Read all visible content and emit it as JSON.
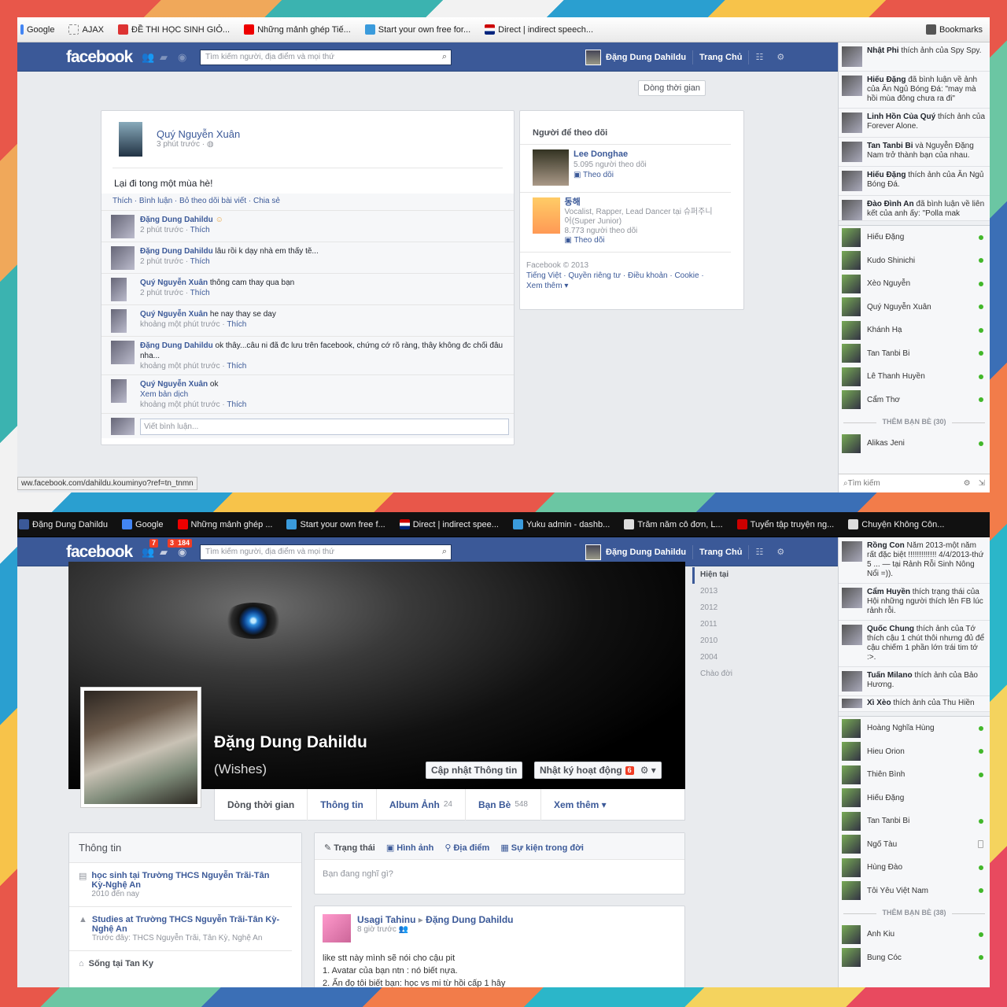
{
  "s1": {
    "bookmarks": [
      "Google",
      "AJAX",
      "ĐỀ THI HỌC SINH GIỎ...",
      "Những mảnh ghép Tiế...",
      "Start your own free for...",
      "Direct | indirect speech..."
    ],
    "bookmarks_right": "Bookmarks",
    "logo": "facebook",
    "search_placeholder": "Tìm kiếm người, địa điểm và mọi thứ",
    "user": "Đặng Dung Dahildu",
    "home": "Trang Chủ",
    "timeline_btn": "Dòng thời gian",
    "post": {
      "author": "Quý Nguyễn Xuân",
      "time": "3 phút trước · ",
      "text": "Lại đi tong một mùa hè!",
      "actions": "Thích · Bình luận · Bỏ theo dõi bài viết · Chia sẻ",
      "comments": [
        {
          "name": "Đặng Dung Dahildu",
          "text": " ",
          "meta": "2 phút trước · ",
          "like": "Thích"
        },
        {
          "name": "Đặng Dung Dahildu",
          "text": " lâu rồi k dạy nhà em thấy tẽ...",
          "meta": "2 phút trước · ",
          "like": "Thích"
        },
        {
          "name": "Quý Nguyễn Xuân",
          "text": " thông cam thay qua bạn",
          "meta": "2 phút trước · ",
          "like": "Thích"
        },
        {
          "name": "Quý Nguyễn Xuân",
          "text": " he nay thay se day",
          "meta": "khoảng một phút trước · ",
          "like": "Thích"
        },
        {
          "name": "Đặng Dung Dahildu",
          "text": " ok thây...câu ni đã đc lưu trên facebook, chứng cớ rõ ràng, thây không đc chối đâu nha...",
          "meta": "khoảng một phút trước · ",
          "like": "Thích"
        },
        {
          "name": "Quý Nguyễn Xuân",
          "text": " ok",
          "extra": "Xem bản dịch",
          "meta": "khoảng một phút trước · ",
          "like": "Thích"
        }
      ],
      "write": "Viết bình luận..."
    },
    "follow": {
      "title": "Người để theo dõi",
      "items": [
        {
          "name": "Lee Donghae",
          "desc": "5.095 người theo dõi",
          "btn": "Theo dõi"
        },
        {
          "name": "동해",
          "desc": "Vocalist, Rapper, Lead Dancer tại 슈퍼주니어(Super Junior)",
          "desc2": "8.773 người theo dõi",
          "btn": "Theo dõi"
        }
      ],
      "footer1": "Facebook © 2013",
      "footer2": "Tiếng Việt · Quyền riêng tư · Điều khoản · Cookie ·",
      "footer3": "Xem thêm ▾"
    },
    "ticker": [
      {
        "name": "Nhật Phi",
        "text": " thích ảnh của Spy Spy."
      },
      {
        "name": "Hiếu Đặng",
        "text": " đã bình luận về ảnh của Ăn Ngủ Bóng Đá: \"may mà hồi mùa đông chưa ra đi\""
      },
      {
        "name": "Linh Hồn Của Quý",
        "text": " thích ảnh của Forever Alone."
      },
      {
        "name": "Tan Tanbi Bi",
        "text": " và Nguyễn Đặng Nam trở thành bạn của nhau."
      },
      {
        "name": "Hiếu Đặng",
        "text": " thích ảnh của Ăn Ngủ Bóng Đá."
      },
      {
        "name": "Đào Đình An",
        "text": " đã bình luận về liên kết của anh ấy: \"Polla mak"
      }
    ],
    "chat": [
      "Hiếu Đặng",
      "Kudo Shinichi",
      "Xèo Nguyễn",
      "Quý Nguyễn Xuân",
      "Khánh Hạ",
      "Tan Tanbi Bi",
      "Lê Thanh Huyền",
      "Cẩm Thơ"
    ],
    "more": "THÊM BẠN BÈ (30)",
    "chat_more": [
      "Alikas Jeni"
    ],
    "search": "Tìm kiếm",
    "status_url": "ww.facebook.com/dahildu.kouminyo?ref=tn_tnmn"
  },
  "s2": {
    "bookmarks": [
      "Đặng Dung Dahildu",
      "Google",
      "Những mảnh ghép ...",
      "Start your own free f...",
      "Direct | indirect spee...",
      "Yuku admin - dashb...",
      "Trăm năm cô đơn, L...",
      "Tuyển tập truyện ng...",
      "Chuyện Không Côn..."
    ],
    "logo": "facebook",
    "badge1": "7",
    "badge2": "3",
    "badge3": "184",
    "search_placeholder": "Tìm kiếm người, địa điểm và mọi thứ",
    "user": "Đặng Dung Dahildu",
    "home": "Trang Chủ",
    "profile_name": "Đặng Dung Dahildu",
    "profile_alt": "(Wishes)",
    "btn_update": "Cập nhật Thông tin",
    "btn_log": "Nhật ký hoạt động",
    "log_count": "6",
    "tabs": [
      {
        "label": "Dòng thời gian",
        "count": ""
      },
      {
        "label": "Thông tin",
        "count": ""
      },
      {
        "label": "Album Ảnh",
        "count": "24"
      },
      {
        "label": "Bạn Bè",
        "count": "548"
      },
      {
        "label": "Xem thêm ▾",
        "count": ""
      }
    ],
    "years": [
      "Hiện tại",
      "2013",
      "2012",
      "2011",
      "2010",
      "2004",
      "Chào đời"
    ],
    "info": {
      "title": "Thông tin",
      "items": [
        {
          "line1": "học sinh tại Trường THCS Nguyễn Trãi-Tân Kỳ-Nghệ An",
          "line2": "2010 đến nay"
        },
        {
          "line1": "Studies at Trường THCS Nguyễn Trãi-Tân Kỳ-Nghệ An",
          "line2": "Trước đây: THCS Nguyễn Trãi, Tân Kỳ, Nghệ An"
        },
        {
          "line1": "Sống tại Tan Ky",
          "line2": ""
        }
      ]
    },
    "composer": {
      "tabs": [
        "Trạng thái",
        "Hình ảnh",
        "Địa điểm",
        "Sự kiện trong đời"
      ],
      "placeholder": "Bạn đang nghĩ gì?"
    },
    "post": {
      "from": "Usagi Tahinu",
      "to": "Đặng Dung Dahildu",
      "time": "8 giờ trước",
      "line1": "like stt này mình sẽ nói cho cậu pit",
      "line2": "1. Avatar của bạn ntn : nó biết nựa.",
      "line3": "2. Ấn đọ tôi biết bạn: học vs mi từ hồi cấp 1 hây"
    },
    "ticker": [
      {
        "name": "Rồng Con",
        "text": " Năm 2013-một năm rất đặc biệt !!!!!!!!!!!!! 4/4/2013-thứ 5 ... — tại Rảnh Rỗi Sinh Nông Nổi =))."
      },
      {
        "name": "Cẩm Huyền",
        "text": " thích trạng thái của Hội những người thích lên FB lúc rảnh rỗi."
      },
      {
        "name": "Quốc Chung",
        "text": " thích ảnh của Tớ thích cậu 1 chút thôi nhưng đủ để cậu chiếm 1 phần lớn trái tim tớ :>."
      },
      {
        "name": "Tuấn Milano",
        "text": " thích ảnh của Bảo Hương."
      },
      {
        "name": "Xì Xèo",
        "text": " thích ảnh của Thu Hiền"
      }
    ],
    "chat": [
      "Hoàng Nghĩa Hùng",
      "Hieu Orion",
      "Thiên Bình",
      "Hiếu Đặng",
      "Tan Tanbi Bi",
      "Ngố Tàu",
      "Hùng Đào",
      "Tôi Yêu Việt Nam"
    ],
    "more": "THÊM BẠN BÈ (38)",
    "chat_more": [
      "Anh Kiu",
      "Bung Cóc"
    ]
  }
}
